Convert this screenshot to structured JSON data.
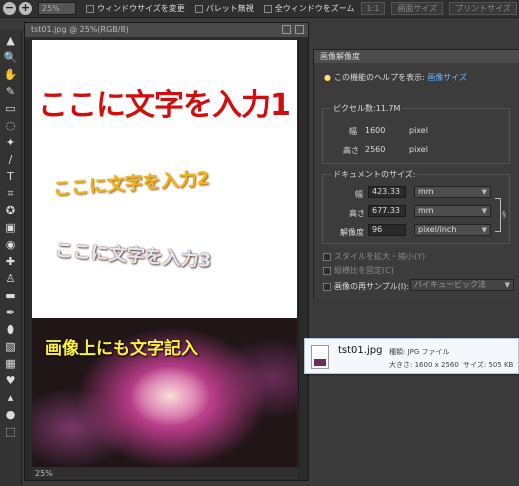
{
  "options_bar": {
    "zoom_out_glyph": "−",
    "zoom_in_glyph": "+",
    "zoom_value": "25%",
    "checkbox_resize_window": "ウィンドウサイズを変更",
    "checkbox_ignore_palettes": "パレット無視",
    "checkbox_zoom_all_windows": "全ウィンドウをズーム",
    "btn_actual_pixels": "1:1",
    "btn_fit_screen": "画面サイズ",
    "btn_print_size": "プリントサイズ"
  },
  "document": {
    "title": "tst01.jpg @ 25%(RGB/8)",
    "zoom_status": "25%",
    "text_line_1": "ここに文字を入力1",
    "text_line_2": "ここに文字を入力2",
    "text_line_3": "ここに文字を入力3",
    "text_on_image": "画像上にも文字記入"
  },
  "panel": {
    "title": "画像解像度",
    "help_prefix": "この機能のヘルプを表示:",
    "help_link": "画像サイズ",
    "pixel_dimensions_label": "ピクセル数:11.7M",
    "width_label": "幅",
    "width_px_value": "1600",
    "width_px_unit": "pixel",
    "height_label": "高さ",
    "height_px_value": "2560",
    "height_px_unit": "pixel",
    "document_size_label": "ドキュメントのサイズ:",
    "doc_width_label": "幅",
    "doc_width_value": "423.33",
    "doc_width_unit": "mm",
    "doc_height_label": "高さ",
    "doc_height_value": "677.33",
    "doc_height_unit": "mm",
    "resolution_label": "解像度",
    "resolution_value": "96",
    "resolution_unit": "pixel/inch",
    "scale_styles": "スタイルを拡大・縮小(Y)",
    "constrain_proportions": "縦横比を固定(C)",
    "resample": "画像の再サンプル(I):",
    "resample_method": "バイキュービック法"
  },
  "tooltip": {
    "file_name": "tst01.jpg",
    "type_label": "種類: JPG ファイル",
    "dimensions_label": "大きさ: 1600 x 2560",
    "size_label": "サイズ: 505 KB"
  },
  "tools": [
    {
      "glyph": "▲",
      "name": "move-tool-icon"
    },
    {
      "glyph": "🔍",
      "name": "zoom-tool-icon"
    },
    {
      "glyph": "✋",
      "name": "hand-tool-icon"
    },
    {
      "glyph": "✎",
      "name": "eyedropper-tool-icon"
    },
    {
      "glyph": "▭",
      "name": "marquee-tool-icon"
    },
    {
      "glyph": "◌",
      "name": "lasso-tool-icon"
    },
    {
      "glyph": "✦",
      "name": "magic-wand-tool-icon"
    },
    {
      "glyph": "∕",
      "name": "selection-brush-tool-icon"
    },
    {
      "glyph": "T",
      "name": "type-tool-icon"
    },
    {
      "glyph": "⌗",
      "name": "crop-tool-icon"
    },
    {
      "glyph": "✪",
      "name": "cookie-cutter-tool-icon"
    },
    {
      "glyph": "▣",
      "name": "straighten-tool-icon"
    },
    {
      "glyph": "◉",
      "name": "red-eye-tool-icon"
    },
    {
      "glyph": "✚",
      "name": "healing-brush-tool-icon"
    },
    {
      "glyph": "♙",
      "name": "clone-stamp-tool-icon"
    },
    {
      "glyph": "▬",
      "name": "eraser-tool-icon"
    },
    {
      "glyph": "✒",
      "name": "pencil-tool-icon"
    },
    {
      "glyph": "⬮",
      "name": "brush-tool-icon"
    },
    {
      "glyph": "▧",
      "name": "gradient-tool-icon"
    },
    {
      "glyph": "▦",
      "name": "paint-bucket-tool-icon"
    },
    {
      "glyph": "♥",
      "name": "shape-tool-icon"
    },
    {
      "glyph": "▴",
      "name": "blur-tool-icon"
    },
    {
      "glyph": "●",
      "name": "sponge-tool-icon"
    },
    {
      "glyph": "⬚",
      "name": "color-swatches-icon"
    }
  ]
}
